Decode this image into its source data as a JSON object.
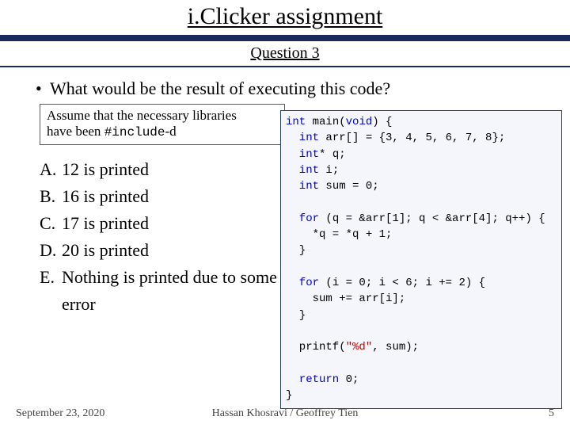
{
  "title": "i.Clicker assignment",
  "subtitle": "Question 3",
  "question_bullet": "•",
  "question": "What would be the result of executing this code?",
  "note": {
    "line1": "Assume that the necessary libraries",
    "line2_a": "have been ",
    "line2_b": "#include",
    "line2_c": "-d"
  },
  "answers": [
    {
      "label": "A.",
      "text": "12 is printed"
    },
    {
      "label": "B.",
      "text": "16 is printed"
    },
    {
      "label": "C.",
      "text": "17 is printed"
    },
    {
      "label": "D.",
      "text": "20 is printed"
    },
    {
      "label": "E.",
      "text": "Nothing is printed due to some error"
    }
  ],
  "code": {
    "t": {
      "int": "int",
      "main": " main(",
      "void": "void",
      "mainEnd": ") {",
      "arr": "  int",
      "arrRest": " arr[] = {3, 4, 5, 6, 7, 8};",
      "qdecl": "  int",
      "qrest": "* q;",
      "idecl": "  int",
      "irest": " i;",
      "sumd": "  int",
      "sumr": " sum = 0;",
      "blank": "",
      "for1a": "  for",
      "for1b": " (q = &arr[1]; q < &arr[4]; q++) {",
      "body1": "    *q = *q + 1;",
      "close1": "  }",
      "for2a": "  for",
      "for2b": " (i = 0; i < 6; i += 2) {",
      "body2": "    sum += arr[i];",
      "close2": "  }",
      "printf": "  printf(",
      "fmt": "\"%d\"",
      "printfEnd": ", sum);",
      "ret": "  return",
      "retEnd": " 0;",
      "end": "}"
    }
  },
  "footer": {
    "date": "September 23, 2020",
    "authors": "Hassan Khosravi / Geoffrey Tien",
    "page": "5"
  }
}
